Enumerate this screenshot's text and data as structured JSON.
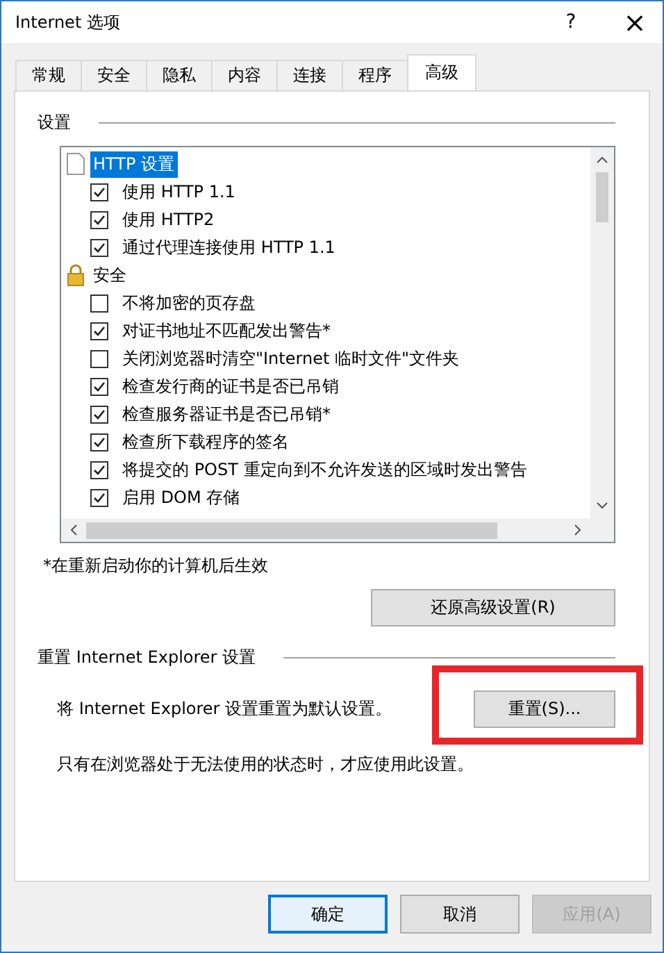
{
  "window": {
    "title": "Internet 选项",
    "help": "?",
    "close": "×"
  },
  "tabs": [
    {
      "label": "常规",
      "selected": false
    },
    {
      "label": "安全",
      "selected": false
    },
    {
      "label": "隐私",
      "selected": false
    },
    {
      "label": "内容",
      "selected": false
    },
    {
      "label": "连接",
      "selected": false
    },
    {
      "label": "程序",
      "selected": false
    },
    {
      "label": "高级",
      "selected": true
    }
  ],
  "settings": {
    "title": "设置",
    "items": [
      {
        "kind": "page-header",
        "label": "HTTP 设置",
        "selected": true
      },
      {
        "kind": "checkbox",
        "label": "使用 HTTP 1.1",
        "checked": true,
        "selected": false
      },
      {
        "kind": "checkbox",
        "label": "使用 HTTP2",
        "checked": true,
        "selected": false
      },
      {
        "kind": "checkbox",
        "label": "通过代理连接使用 HTTP 1.1",
        "checked": true,
        "selected": false
      },
      {
        "kind": "lock-header",
        "label": "安全",
        "selected": false
      },
      {
        "kind": "checkbox",
        "label": "不将加密的页存盘",
        "checked": false,
        "selected": false
      },
      {
        "kind": "checkbox",
        "label": "对证书地址不匹配发出警告*",
        "checked": true,
        "selected": false
      },
      {
        "kind": "checkbox",
        "label": "关闭浏览器时清空\"Internet 临时文件\"文件夹",
        "checked": false,
        "selected": false
      },
      {
        "kind": "checkbox",
        "label": "检查发行商的证书是否已吊销",
        "checked": true,
        "selected": false
      },
      {
        "kind": "checkbox",
        "label": "检查服务器证书是否已吊销*",
        "checked": true,
        "selected": false
      },
      {
        "kind": "checkbox",
        "label": "检查所下载程序的签名",
        "checked": true,
        "selected": false
      },
      {
        "kind": "checkbox",
        "label": "将提交的 POST 重定向到不允许发送的区域时发出警告",
        "checked": true,
        "selected": false
      },
      {
        "kind": "checkbox",
        "label": "启用 DOM 存储",
        "checked": true,
        "selected": false
      }
    ],
    "note": "*在重新启动你的计算机后生效",
    "restore_button": "还原高级设置(R)"
  },
  "reset": {
    "title": "重置 Internet Explorer 设置",
    "description": "将 Internet Explorer 设置重置为默认设置。",
    "button": "重置(S)...",
    "highlighted": true,
    "warning": "只有在浏览器处于无法使用的状态时，才应使用此设置。"
  },
  "buttons": [
    {
      "label": "确定",
      "default": true,
      "disabled": false
    },
    {
      "label": "取消",
      "default": false,
      "disabled": false
    },
    {
      "label": "应用(A)",
      "default": false,
      "disabled": true
    }
  ]
}
